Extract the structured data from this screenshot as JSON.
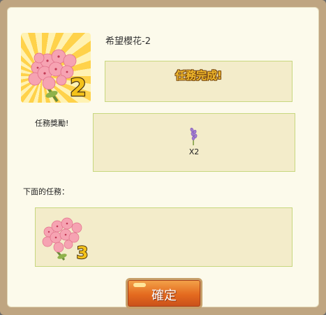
{
  "quest": {
    "title": "希望櫻花-2",
    "icon_number": "2",
    "status_text": "任務完成!"
  },
  "reward": {
    "heading": "任務獎勵!",
    "item_icon": "lavender-icon",
    "count": "X2"
  },
  "next": {
    "heading": "下面的任務：",
    "icon_number": "3"
  },
  "confirm": {
    "label": "確定"
  },
  "colors": {
    "panel_bg": "#fcfaeb",
    "box_bg": "#f3ecca",
    "box_border": "#c7d77e",
    "button_orange": "#e46a1f",
    "complete_gold": "#f0b82c"
  }
}
